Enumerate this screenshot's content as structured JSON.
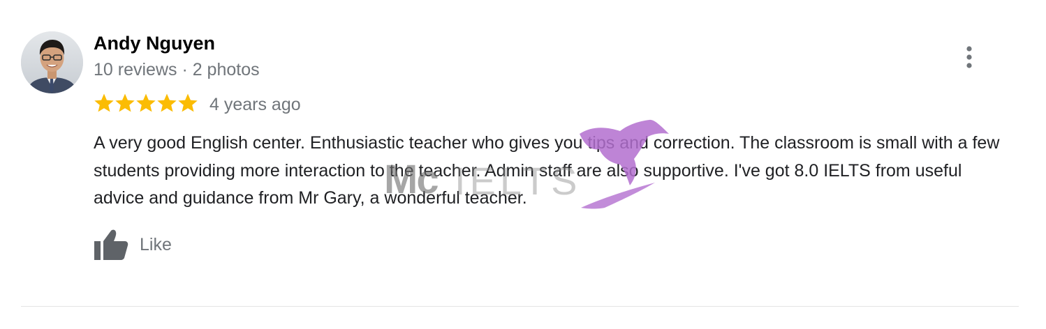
{
  "review": {
    "author": {
      "name": "Andy Nguyen",
      "meta": "10 reviews · 2 photos"
    },
    "rating": {
      "stars": 5,
      "max": 5
    },
    "date": "4 years ago",
    "text": "A very good English center. Enthusiastic teacher who gives you tips and correction. The classroom is small with a few students providing more interaction to the teacher. Admin staff are also supportive. I've got 8.0 IELTS from useful advice and guidance from Mr Gary, a wonderful teacher.",
    "actions": {
      "like_label": "Like"
    }
  },
  "watermark": {
    "brand_part1": "Mc",
    "brand_part2": "IELTS"
  },
  "icons": {
    "menu": "more-vert-icon",
    "star": "star-icon",
    "like": "thumb-up-icon"
  },
  "colors": {
    "star": "#fbbc04",
    "secondary_text": "#70757a",
    "primary_text": "#202124",
    "watermark_bird": "#b36fcf"
  }
}
